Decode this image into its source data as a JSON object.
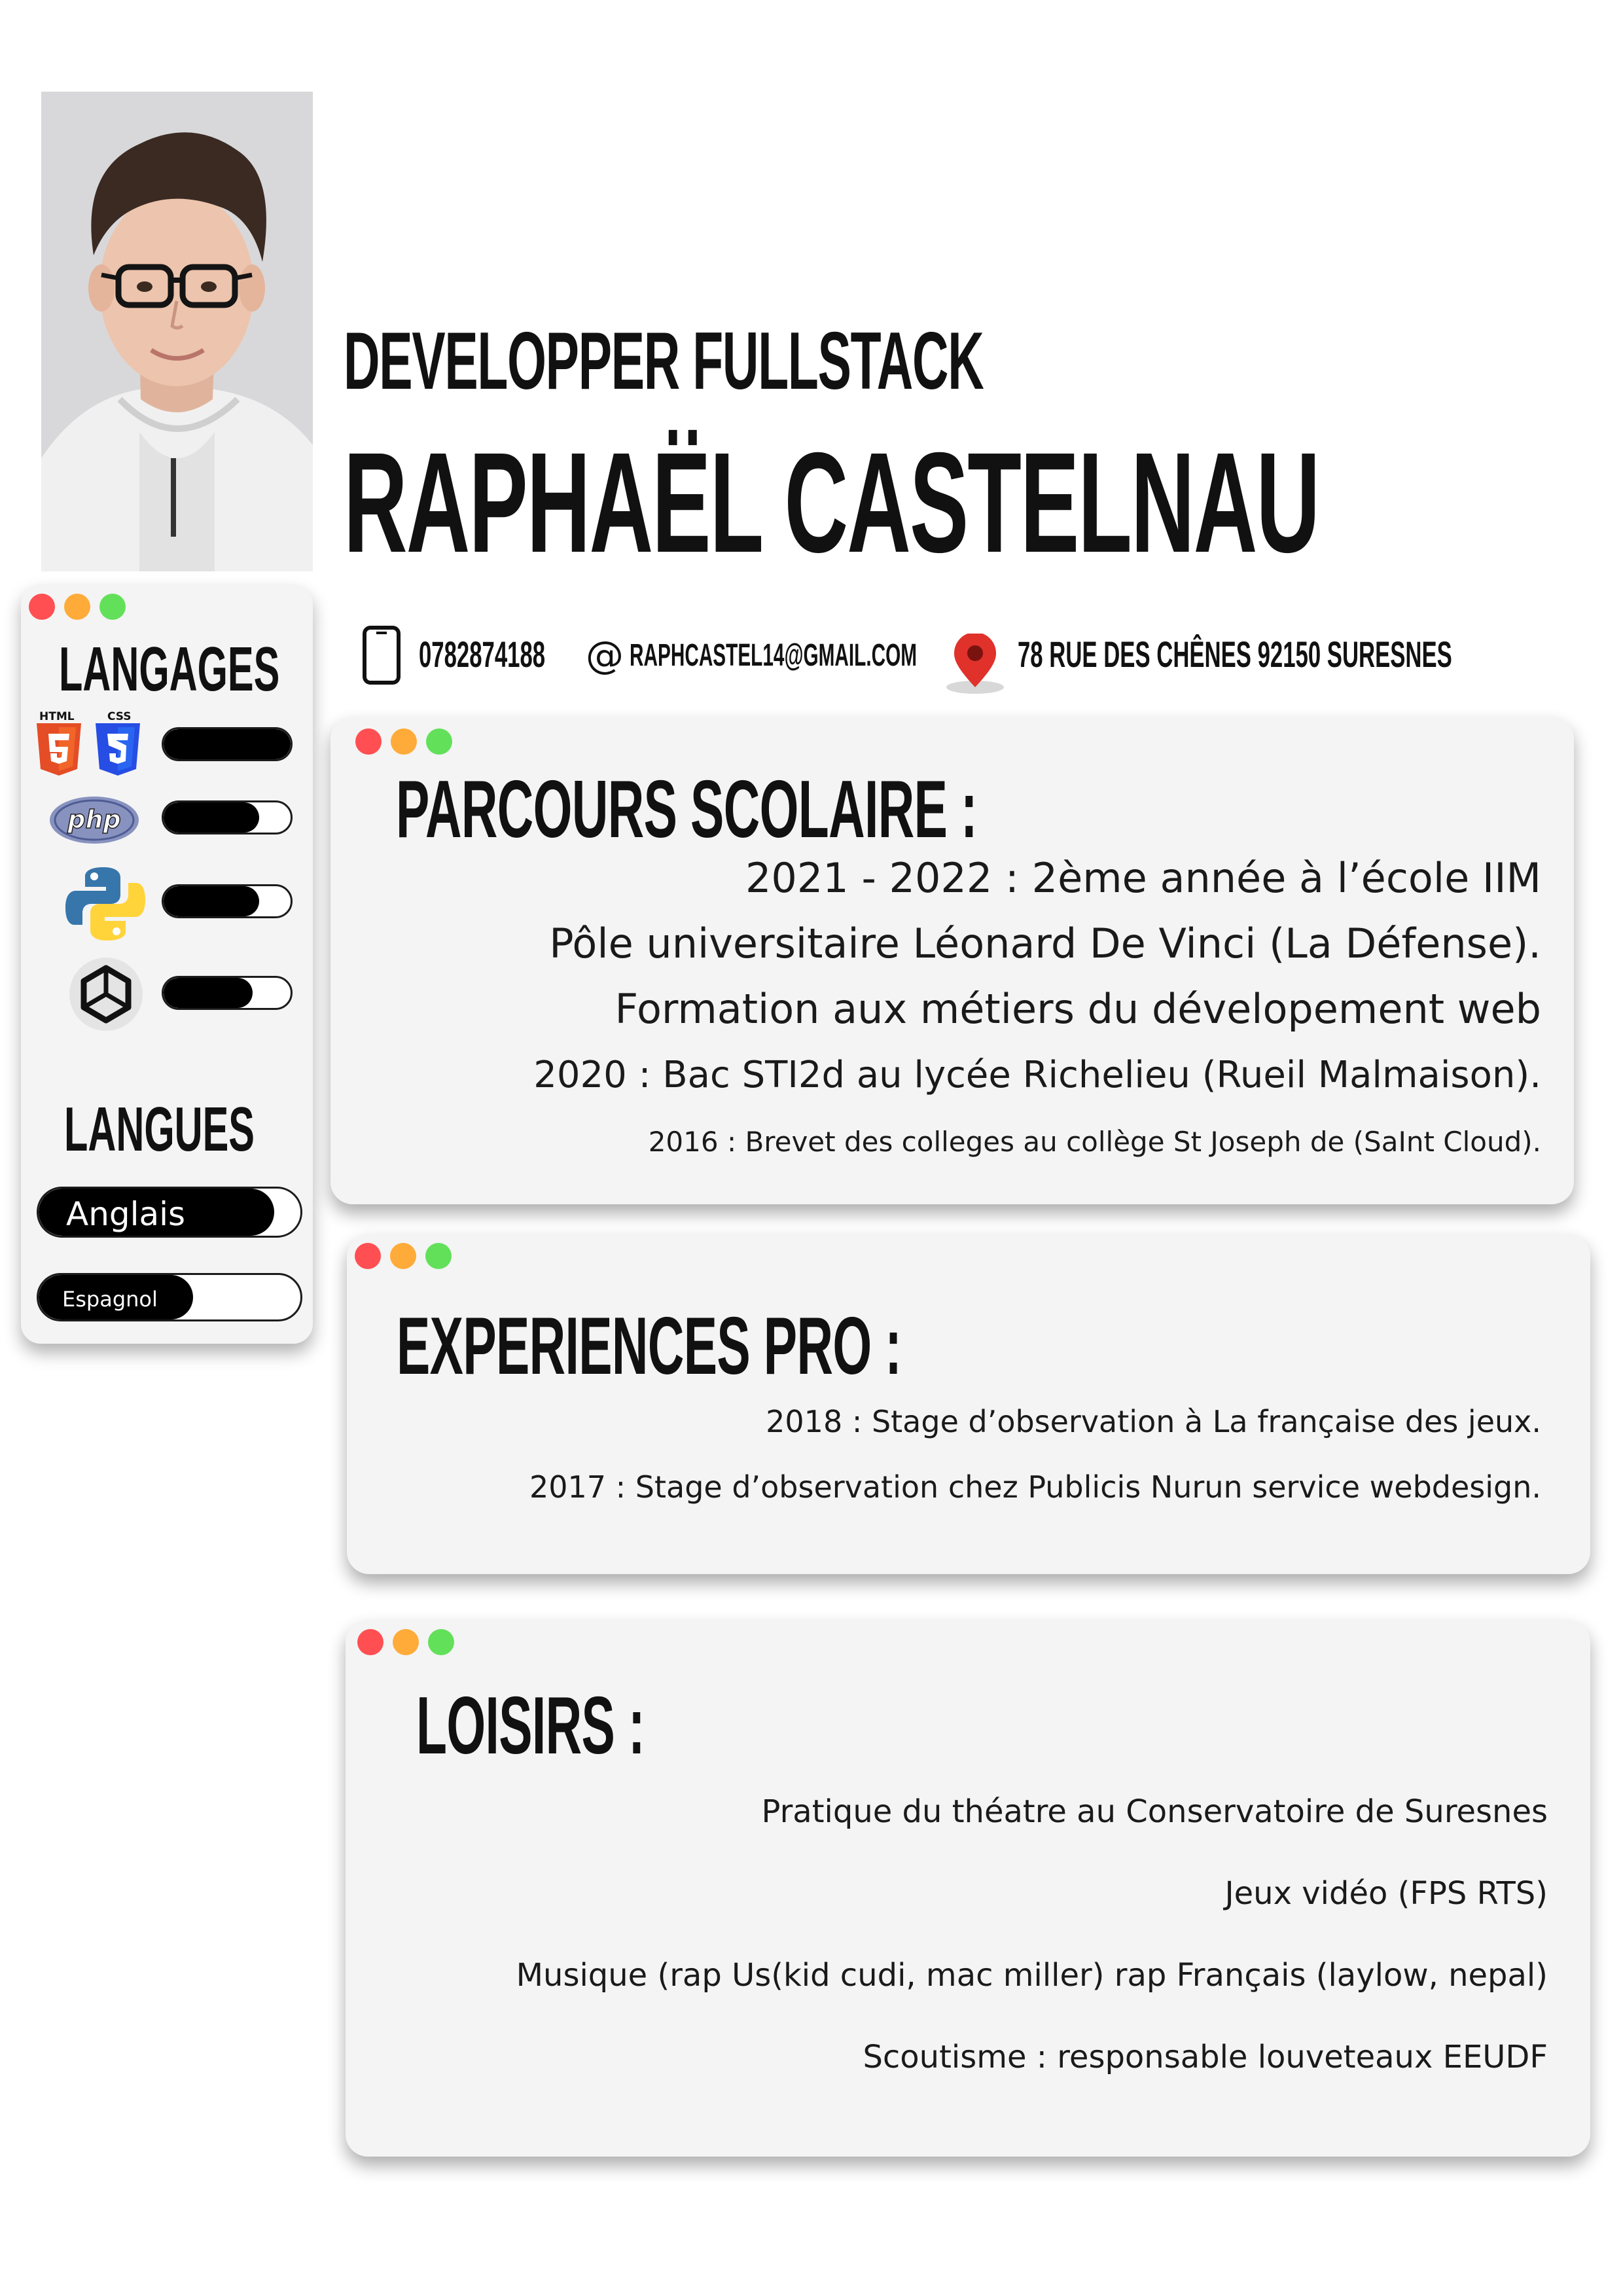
{
  "header": {
    "role": "DEVELOPPER FULLSTACK",
    "name": "RAPHAËL CASTELNAU"
  },
  "contact": {
    "phone": "0782874188",
    "email_symbol": "@",
    "email": "RAPHCASTEL14@GMAIL.COM",
    "address": "78 RUE DES CHÊNES 92150  SURESNES"
  },
  "sidebar": {
    "languages_title": "LANGAGES",
    "skills": [
      {
        "icon": "html-css-icon",
        "html_label": "HTML",
        "css_label": "CSS",
        "level": 1.0
      },
      {
        "icon": "php-icon",
        "label": "php",
        "level": 0.75
      },
      {
        "icon": "python-icon",
        "level": 0.75
      },
      {
        "icon": "unity-icon",
        "level": 0.7
      }
    ],
    "spoken_title": "LANGUES",
    "spoken": [
      {
        "label": "Anglais",
        "level": 0.9
      },
      {
        "label": "Espagnol",
        "level": 0.59
      }
    ]
  },
  "education": {
    "title": "PARCOURS SCOLAIRE :",
    "lines": [
      "2021 - 2022 : 2ème année à l’école IIM",
      "Pôle universitaire Léonard De Vinci (La Défense).",
      "Formation aux métiers du dévelopement web",
      "2020 : Bac STI2d au lycée Richelieu (Rueil Malmaison).",
      "2016 : Brevet des colleges au collège St Joseph de (SaInt Cloud)."
    ]
  },
  "experience": {
    "title": "EXPERIENCES PRO :",
    "lines": [
      "2018 : Stage d’observation à La française des jeux.",
      "2017 : Stage d’observation chez Publicis Nurun service webdesign."
    ]
  },
  "hobbies": {
    "title": "LOISIRS :",
    "lines": [
      "Pratique du théatre au Conservatoire de Suresnes",
      "Jeux vidéo (FPS RTS)",
      "Musique (rap Us(kid cudi, mac miller) rap Français (laylow, nepal)",
      "Scoutisme : responsable louveteaux EEUDF"
    ]
  },
  "colors": {
    "dot_red": "#ff4f52",
    "dot_yellow": "#ffab3a",
    "dot_green": "#63e05a",
    "card_bg": "#f4f4f4",
    "html_orange": "#e44d26",
    "css_blue": "#264de4",
    "php_purple": "#8892bf",
    "python_blue": "#3776ab",
    "python_yellow": "#ffd43b",
    "pin_red": "#e0312b"
  }
}
